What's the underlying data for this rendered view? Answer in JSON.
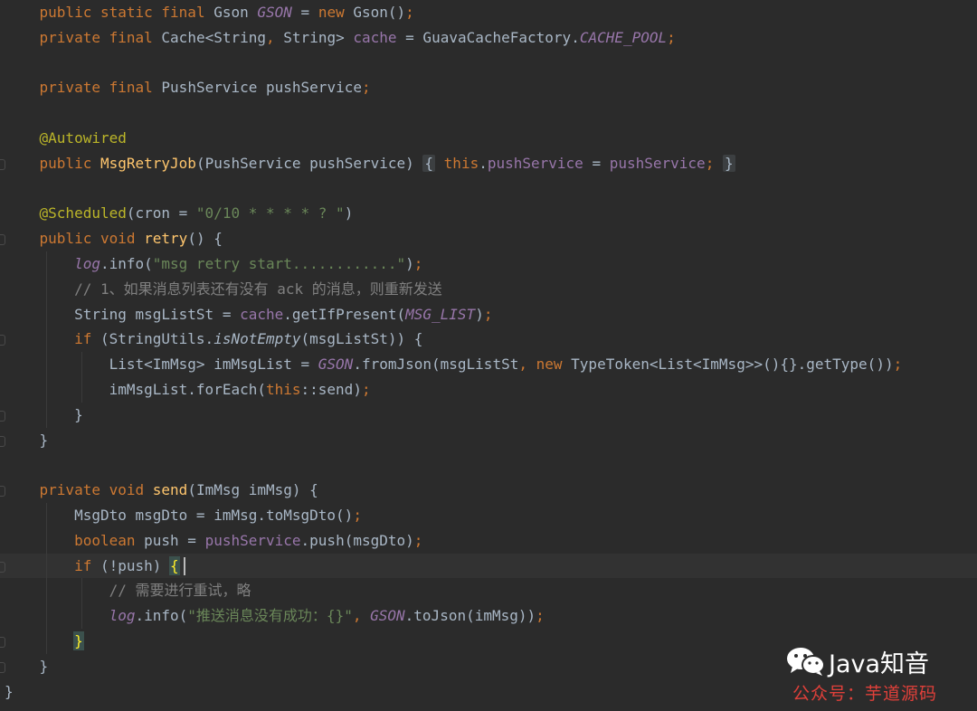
{
  "editor": {
    "lines": [
      "    public static final Gson GSON = new Gson();",
      "    private final Cache<String, String> cache = GuavaCacheFactory.CACHE_POOL;",
      "",
      "    private final PushService pushService;",
      "",
      "    @Autowired",
      "    public MsgRetryJob(PushService pushService) { this.pushService = pushService; }",
      "",
      "    @Scheduled(cron = \"0/10 * * * * ? \")",
      "    public void retry() {",
      "        log.info(\"msg retry start............\");",
      "        // 1、如果消息列表还有没有 ack 的消息，则重新发送",
      "        String msgListSt = cache.getIfPresent(MSG_LIST);",
      "        if (StringUtils.isNotEmpty(msgListSt)) {",
      "            List<ImMsg> imMsgList = GSON.fromJson(msgListSt, new TypeToken<List<ImMsg>>(){}.getType());",
      "            imMsgList.forEach(this::send);",
      "        }",
      "    }",
      "",
      "    private void send(ImMsg imMsg) {",
      "        MsgDto msgDto = imMsg.toMsgDto();",
      "        boolean push = pushService.push(msgDto);",
      "        if (!push) {",
      "            // 需要进行重试，略",
      "            log.info(\"推送消息没有成功：{}\", GSON.toJson(imMsg));",
      "        }",
      "    }",
      "}"
    ],
    "colors": {
      "background": "#2b2b2b",
      "keyword": "#cc7832",
      "method": "#ffc66d",
      "field": "#9876aa",
      "string": "#6a8759",
      "annotation": "#bbb529",
      "comment": "#808080",
      "text": "#a9b7c6"
    }
  },
  "watermark": {
    "title": "Java知音",
    "subtitle": "公众号：芋道源码",
    "logo_icon": "wechat-icon"
  }
}
